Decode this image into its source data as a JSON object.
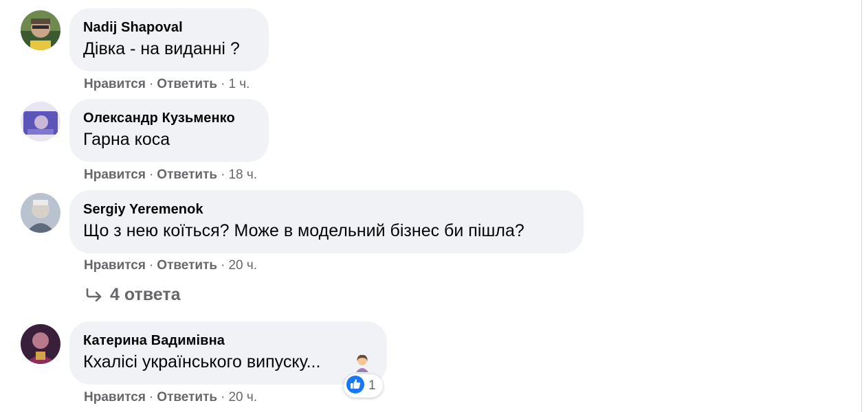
{
  "comments": [
    {
      "author": "Nadij Shapoval",
      "text": "Дівка - на виданні ?",
      "like_label": "Нравится",
      "reply_label": "Ответить",
      "separator": "·",
      "time": "1 ч."
    },
    {
      "author": "Олександр Кузьменко",
      "text": "Гарна коса",
      "like_label": "Нравится",
      "reply_label": "Ответить",
      "separator": "·",
      "time": "18 ч."
    },
    {
      "author": "Sergiy Yeremenok",
      "text": "Що з нею коїться? Може в модельний бізнес би пішла?",
      "like_label": "Нравится",
      "reply_label": "Ответить",
      "separator": "·",
      "time": "20 ч.",
      "replies_label": "4 ответа",
      "replies_icon": "reply-arrow-icon"
    },
    {
      "author": "Катерина Вадимівна",
      "text": "Кхалісі українського випуску...",
      "emoji": "woman-emoji-icon",
      "like_label": "Нравится",
      "reply_label": "Ответить",
      "separator": "·",
      "time": "20 ч.",
      "reaction": {
        "icon": "like-icon",
        "count": "1",
        "color": "#1877f2"
      }
    }
  ],
  "colors": {
    "bubble": "#f0f2f5",
    "text": "#050505",
    "secondary": "#65676b",
    "like_blue": "#1877f2"
  }
}
